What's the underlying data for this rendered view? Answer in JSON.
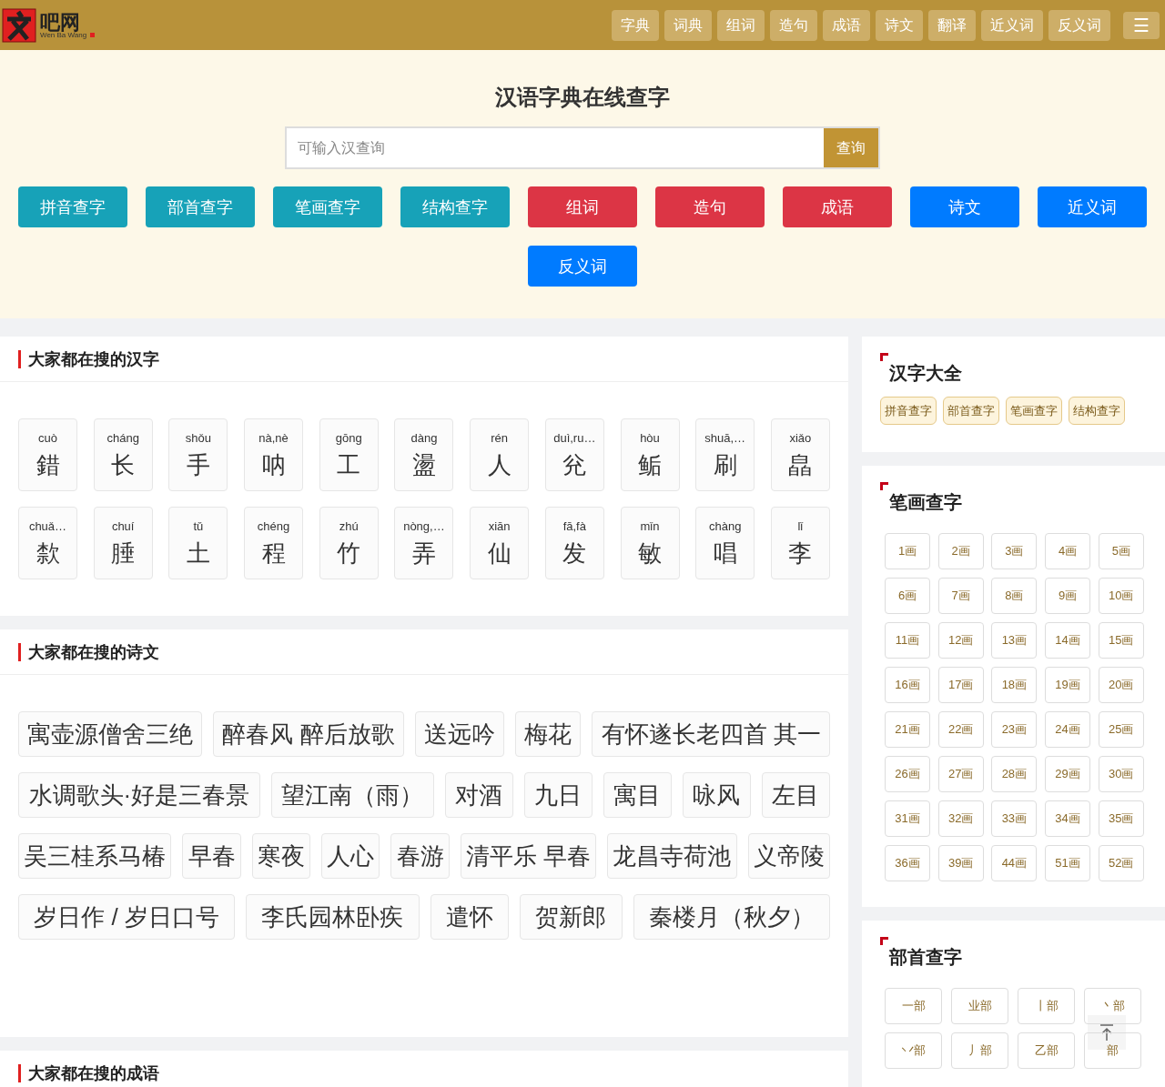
{
  "header": {
    "logo_text": "吧网",
    "logo_sub": "Wen Ba Wang",
    "nav": [
      "字典",
      "词典",
      "组词",
      "造句",
      "成语",
      "诗文",
      "翻译",
      "近义词",
      "反义词"
    ],
    "menu_icon": "☰"
  },
  "hero": {
    "title": "汉语字典在线查字",
    "search": {
      "placeholder": "可输入汉查询",
      "button": "查询"
    },
    "buttons": [
      {
        "label": "拼音查字",
        "color": "#17a2b8"
      },
      {
        "label": "部首查字",
        "color": "#17a2b8"
      },
      {
        "label": "笔画查字",
        "color": "#17a2b8"
      },
      {
        "label": "结构查字",
        "color": "#17a2b8"
      },
      {
        "label": "组词",
        "color": "#dc3545"
      },
      {
        "label": "造句",
        "color": "#dc3545"
      },
      {
        "label": "成语",
        "color": "#dc3545"
      },
      {
        "label": "诗文",
        "color": "#007bff"
      },
      {
        "label": "近义词",
        "color": "#007bff"
      },
      {
        "label": "反义词",
        "color": "#007bff"
      }
    ]
  },
  "popular_chars": {
    "title": "大家都在搜的汉字",
    "items": [
      {
        "pinyin": "cuò",
        "char": "錯"
      },
      {
        "pinyin": "cháng",
        "char": "长"
      },
      {
        "pinyin": "shǒu",
        "char": "手"
      },
      {
        "pinyin": "nà,nè",
        "char": "呐"
      },
      {
        "pinyin": "gōng",
        "char": "工"
      },
      {
        "pinyin": "dàng",
        "char": "盪"
      },
      {
        "pinyin": "rén",
        "char": "人"
      },
      {
        "pinyin": "duì,ru…",
        "char": "兊"
      },
      {
        "pinyin": "hòu",
        "char": "鲘"
      },
      {
        "pinyin": "shuā,…",
        "char": "刷"
      },
      {
        "pinyin": "xiǎo",
        "char": "皛"
      },
      {
        "pinyin": "chuǎ…",
        "char": "歀"
      },
      {
        "pinyin": "chuí",
        "char": "腄"
      },
      {
        "pinyin": "tǔ",
        "char": "土"
      },
      {
        "pinyin": "chéng",
        "char": "程"
      },
      {
        "pinyin": "zhú",
        "char": "竹"
      },
      {
        "pinyin": "nòng,…",
        "char": "弄"
      },
      {
        "pinyin": "xiān",
        "char": "仙"
      },
      {
        "pinyin": "fā,fà",
        "char": "发"
      },
      {
        "pinyin": "mǐn",
        "char": "敏"
      },
      {
        "pinyin": "chàng",
        "char": "唱"
      },
      {
        "pinyin": "lǐ",
        "char": "李"
      }
    ]
  },
  "popular_poems": {
    "title": "大家都在搜的诗文",
    "items": [
      "寓壶源僧舍三绝",
      "醉春风 醉后放歌",
      "送远吟",
      "梅花",
      "有怀遂长老四首 其一",
      "水调歌头·好是三春景",
      "望江南（雨）",
      "对酒",
      "九日",
      "寓目",
      "咏风",
      "左目",
      "吴三桂系马椿",
      "早春",
      "寒夜",
      "人心",
      "春游",
      "清平乐 早春",
      "龙昌寺荷池",
      "义帝陵",
      "岁日作 / 岁日口号",
      "李氏园林卧疾",
      "遣怀",
      "贺新郎",
      "秦楼月（秋夕）"
    ]
  },
  "popular_idioms": {
    "title": "大家都在搜的成语"
  },
  "sidebar": {
    "all": {
      "title": "汉字大全",
      "links": [
        "拼音查字",
        "部首查字",
        "笔画查字",
        "结构查字"
      ]
    },
    "strokes": {
      "title": "笔画查字",
      "items": [
        "1画",
        "2画",
        "3画",
        "4画",
        "5画",
        "6画",
        "7画",
        "8画",
        "9画",
        "10画",
        "11画",
        "12画",
        "13画",
        "14画",
        "15画",
        "16画",
        "17画",
        "18画",
        "19画",
        "20画",
        "21画",
        "22画",
        "23画",
        "24画",
        "25画",
        "26画",
        "27画",
        "28画",
        "29画",
        "30画",
        "31画",
        "32画",
        "33画",
        "34画",
        "35画",
        "36画",
        "39画",
        "44画",
        "51画",
        "52画"
      ]
    },
    "radicals": {
      "title": "部首查字",
      "items": [
        "一部",
        "业部",
        "丨部",
        "丶部",
        "丷部",
        "丿部",
        "乙部",
        "部"
      ]
    }
  }
}
